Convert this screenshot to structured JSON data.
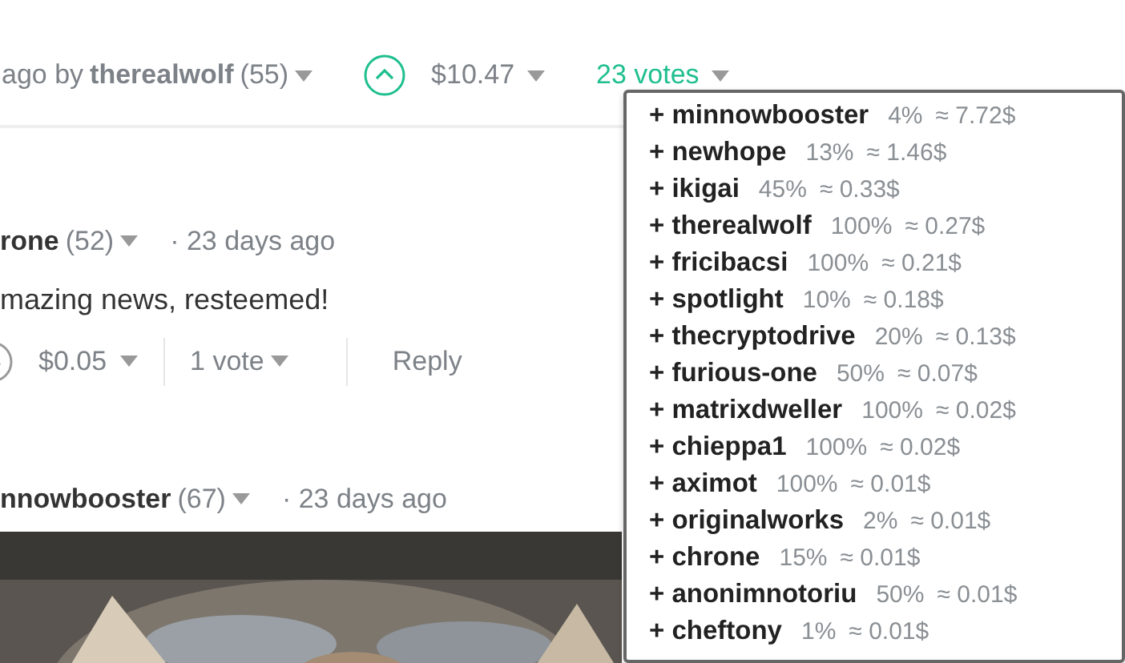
{
  "post_footer": {
    "time_prefix": "ago by",
    "author": "therealwolf",
    "reputation": "(55)",
    "upvoted": true,
    "payout": "$10.47",
    "votes": "23 votes"
  },
  "comments": [
    {
      "author": "rone",
      "reputation": "(52)",
      "time": "· 23 days ago",
      "body": "mazing news, resteemed!",
      "upvoted": false,
      "payout": "$0.05",
      "votes": "1 vote",
      "reply": "Reply"
    },
    {
      "author": "nnowbooster",
      "reputation": "(67)",
      "time": "· 23 days ago"
    }
  ],
  "voters_dropdown": [
    {
      "name": "+ minnowbooster",
      "percent": "4%",
      "value": "≈ 7.72$"
    },
    {
      "name": "+ newhope",
      "percent": "13%",
      "value": "≈ 1.46$"
    },
    {
      "name": "+ ikigai",
      "percent": "45%",
      "value": "≈ 0.33$"
    },
    {
      "name": "+ therealwolf",
      "percent": "100%",
      "value": "≈ 0.27$"
    },
    {
      "name": "+ fricibacsi",
      "percent": "100%",
      "value": "≈ 0.21$"
    },
    {
      "name": "+ spotlight",
      "percent": "10%",
      "value": "≈ 0.18$"
    },
    {
      "name": "+ thecryptodrive",
      "percent": "20%",
      "value": "≈ 0.13$"
    },
    {
      "name": "+ furious-one",
      "percent": "50%",
      "value": "≈ 0.07$"
    },
    {
      "name": "+ matrixdweller",
      "percent": "100%",
      "value": "≈ 0.02$"
    },
    {
      "name": "+ chieppa1",
      "percent": "100%",
      "value": "≈ 0.02$"
    },
    {
      "name": "+ aximot",
      "percent": "100%",
      "value": "≈ 0.01$"
    },
    {
      "name": "+ originalworks",
      "percent": "2%",
      "value": "≈ 0.01$"
    },
    {
      "name": "+ chrone",
      "percent": "15%",
      "value": "≈ 0.01$"
    },
    {
      "name": "+ anonimnotoriu",
      "percent": "50%",
      "value": "≈ 0.01$"
    },
    {
      "name": "+ cheftony",
      "percent": "1%",
      "value": "≈ 0.01$"
    }
  ]
}
